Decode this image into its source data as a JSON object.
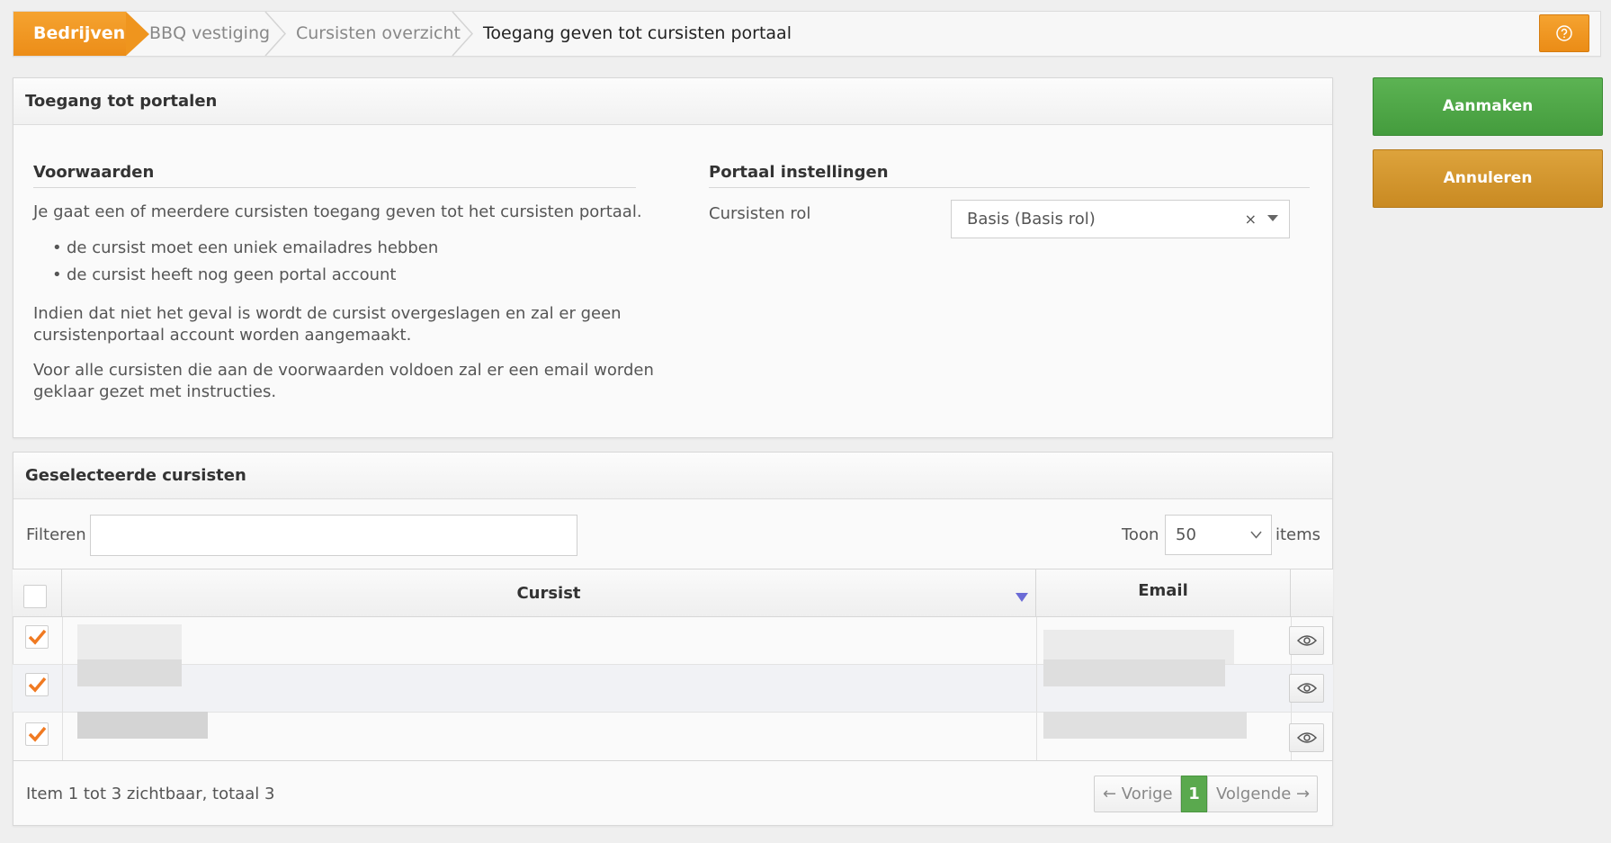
{
  "breadcrumb": {
    "items": [
      "Bedrijven",
      "BBQ vestiging",
      "Cursisten overzicht",
      "Toegang geven tot cursisten portaal"
    ]
  },
  "help_icon": "help-circle-icon",
  "panel_access": {
    "title": "Toegang tot portalen",
    "conditions": {
      "title": "Voorwaarden",
      "intro": "Je gaat een of meerdere cursisten toegang geven tot het cursisten portaal.",
      "bullets": [
        "de cursist moet een uniek emailadres hebben",
        "de cursist heeft nog geen portal account"
      ],
      "para1_line1": "Indien dat niet het geval is wordt de cursist overgeslagen en zal er geen",
      "para1_line2": "cursistenportaal account worden aangemaakt.",
      "para2_line1": "Voor alle cursisten die aan de voorwaarden voldoen zal er een email worden",
      "para2_line2": "geklaar gezet met instructies."
    },
    "settings": {
      "title": "Portaal instellingen",
      "role_label": "Cursisten rol",
      "role_value": "Basis (Basis rol)",
      "clear_glyph": "×"
    }
  },
  "actions": {
    "create": "Aanmaken",
    "cancel": "Annuleren"
  },
  "panel_selected": {
    "title": "Geselecteerde cursisten",
    "filter_label": "Filteren",
    "filter_value": "",
    "show_label": "Toon",
    "show_value": "50",
    "items_label": "items",
    "columns": [
      "Cursist",
      "Email"
    ],
    "rows": [
      {
        "checked": true
      },
      {
        "checked": true
      },
      {
        "checked": true
      }
    ],
    "footer": "Item 1 tot 3 zichtbaar, totaal 3",
    "pager": {
      "prev": "← Vorige",
      "page": "1",
      "next": "Volgende →"
    }
  },
  "colors": {
    "accent_orange": "#ef951e",
    "green": "#4caa44",
    "gold": "#d39530",
    "check_orange": "#f07a22"
  }
}
